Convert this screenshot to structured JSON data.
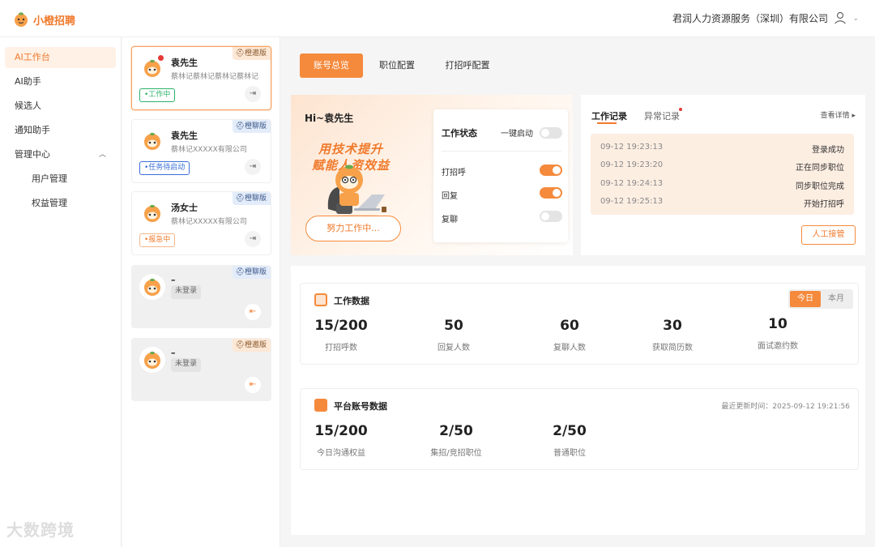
{
  "app": {
    "logo_text": "小橙招聘",
    "company": "君润人力资源服务（深圳）有限公司"
  },
  "sidebar": {
    "items": [
      {
        "label": "AI工作台",
        "active": true
      },
      {
        "label": "AI助手"
      },
      {
        "label": "候选人"
      },
      {
        "label": "通知助手"
      },
      {
        "label": "管理中心",
        "expanded": true
      },
      {
        "label": "用户管理",
        "sub": true
      },
      {
        "label": "权益管理",
        "sub": true
      }
    ]
  },
  "accounts": [
    {
      "name": "袁先生",
      "company": "蔡林记蔡林记蔡林记蔡林记",
      "version": "橙邀版",
      "status": "•工作中",
      "unread": true
    },
    {
      "name": "袁先生",
      "company": "蔡林记XXXXX有限公司",
      "version": "橙聊版",
      "status": "•任务待启动"
    },
    {
      "name": "汤女士",
      "company": "蔡林记XXXXX有限公司",
      "version": "橙聊版",
      "status": "•报急中"
    },
    {
      "name": "–",
      "version": "橙聊版",
      "status": "未登录"
    },
    {
      "name": "–",
      "version": "橙邀版",
      "status": "未登录"
    }
  ],
  "tabs": [
    {
      "label": "账号总览"
    },
    {
      "label": "职位配置"
    },
    {
      "label": "打招呼配置"
    }
  ],
  "welcome": {
    "greeting": "Hi~袁先生",
    "slogan_line1": "用技术提升",
    "slogan_line2": "赋能人资效益",
    "button": "努力工作中...",
    "status_title": "工作状态",
    "one_key_label": "一键启动",
    "one_key_on": false,
    "toggles": [
      {
        "label": "打招呼",
        "on": true
      },
      {
        "label": "回复",
        "on": true
      },
      {
        "label": "复聊",
        "on": false
      }
    ]
  },
  "work_log": {
    "tabs": [
      "工作记录",
      "异常记录"
    ],
    "detail_link": "查看详情",
    "rows": [
      {
        "time": "09-12 19:23:13",
        "msg": "登录成功"
      },
      {
        "time": "09-12 19:23:20",
        "msg": "正在同步职位"
      },
      {
        "time": "09-12 19:24:13",
        "msg": "同步职位完成"
      },
      {
        "time": "09-12 19:25:13",
        "msg": "开始打招呼"
      }
    ],
    "manual_button": "人工接管"
  },
  "work_data": {
    "title": "工作数据",
    "periods": [
      "今日",
      "本月"
    ],
    "stats": [
      {
        "value": "15/200",
        "label": "打招呼数"
      },
      {
        "value": "50",
        "label": "回复人数"
      },
      {
        "value": "60",
        "label": "复聊人数"
      },
      {
        "value": "30",
        "label": "获取简历数"
      },
      {
        "value": "10",
        "label": "面试邀约数"
      }
    ]
  },
  "platform_data": {
    "title": "平台账号数据",
    "updated": "最近更新时间：2025-09-12 19:21:56",
    "stats": [
      {
        "value": "15/200",
        "label": "今日沟通权益"
      },
      {
        "value": "2/50",
        "label": "集招/竞招职位"
      },
      {
        "value": "2/50",
        "label": "普通职位"
      }
    ]
  },
  "watermark": "大数跨境",
  "colors": {
    "accent": "#f58a3c",
    "accent_text": "#f07a2c"
  }
}
